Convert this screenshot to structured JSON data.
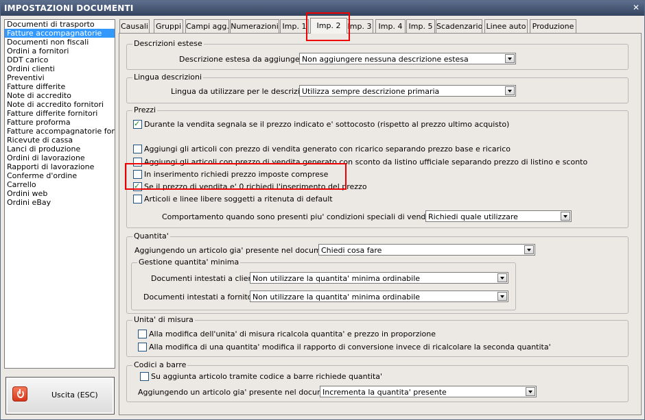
{
  "window": {
    "title": "IMPOSTAZIONI DOCUMENTI",
    "close_glyph": "✕"
  },
  "sidebar": {
    "items": [
      "Documenti di trasporto",
      "Fatture accompagnatorie",
      "Documenti non fiscali",
      "Ordini a fornitori",
      "DDT carico",
      "Ordini clienti",
      "Preventivi",
      "Fatture differite",
      "Note di accredito",
      "Note di accredito fornitori",
      "Fatture differite fornitori",
      "Fatture proforma",
      "Fatture accompagnatorie fornito",
      "Ricevute di cassa",
      "Lanci di produzione",
      "Ordini di lavorazione",
      "Rapporti di lavorazione",
      "Conferme d'ordine",
      "Carrello",
      "Ordini web",
      "Ordini eBay"
    ],
    "selected_index": 1
  },
  "exit_button": {
    "label": "Uscita (ESC)"
  },
  "tabs": [
    "Causali",
    "Gruppi",
    "Campi agg.",
    "Numerazioni",
    "Imp. 1",
    "Imp. 2",
    "Imp. 3",
    "Imp. 4",
    "Imp. 5",
    "Scadenzario",
    "Linee auto",
    "Produzione"
  ],
  "active_tab": "Imp. 2",
  "descrizioni_estese": {
    "legend": "Descrizioni estese",
    "label": "Descrizione estesa da aggiungere :",
    "value": "Non aggiungere nessuna descrizione estesa"
  },
  "lingua": {
    "legend": "Lingua descrizioni",
    "label": "Lingua da utilizzare per le descrizioni :",
    "value": "Utilizza sempre descrizione primaria"
  },
  "prezzi": {
    "legend": "Prezzi",
    "checks": [
      {
        "label": "Durante la vendita segnala se il prezzo indicato e' sottocosto (rispetto al prezzo ultimo acquisto)",
        "checked": true
      },
      {
        "label": "Aggiungi gli articoli con prezzo di vendita generato con ricarico separando prezzo base e ricarico",
        "checked": false
      },
      {
        "label": "Aggiungi gli articoli con prezzo di vendita generato con sconto da listino ufficiale separando prezzo di listino e sconto",
        "checked": false
      },
      {
        "label": "In inserimento richiedi prezzo imposte comprese",
        "checked": false
      },
      {
        "label": "Se il prezzo di vendita e' 0 richiedi l'inserimento del prezzo",
        "checked": true
      },
      {
        "label": "Articoli e linee libere soggetti a ritenuta di default",
        "checked": false
      }
    ],
    "cond_label": "Comportamento quando sono presenti piu' condizioni speciali di vendita valide :",
    "cond_value": "Richiedi quale utilizzare"
  },
  "quantita": {
    "legend": "Quantita'",
    "label": "Aggiungendo un articolo gia' presente nel documento :",
    "value": "Chiedi cosa fare",
    "minima": {
      "legend": "Gestione quantita' minima",
      "clienti_label": "Documenti intestati a clienti :",
      "clienti_value": "Non utilizzare la quantita' minima ordinabile",
      "fornitori_label": "Documenti intestati a fornitori :",
      "fornitori_value": "Non utilizzare la quantita' minima ordinabile"
    }
  },
  "unita": {
    "legend": "Unita' di misura",
    "checks": [
      {
        "label": "Alla modifica dell'unita' di misura ricalcola quantita' e prezzo in proporzione",
        "checked": false
      },
      {
        "label": "Alla modifica di una quantita' modifica il rapporto di conversione invece di ricalcolare la seconda quantita'",
        "checked": false
      }
    ]
  },
  "barre": {
    "legend": "Codici a barre",
    "check": {
      "label": "Su aggiunta articolo tramite codice a barre richiede quantita'",
      "checked": false
    },
    "label": "Aggiungendo un articolo gia' presente nel documento :",
    "value": "Incrementa la quantita' presente"
  }
}
